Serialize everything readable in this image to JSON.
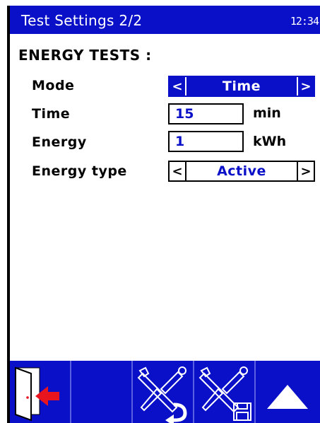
{
  "window": {
    "title": "Test Settings 2/2",
    "clock": "12:34"
  },
  "section": {
    "title": "ENERGY TESTS :"
  },
  "fields": {
    "mode": {
      "label": "Mode",
      "value": "Time",
      "left": "<",
      "right": ">"
    },
    "time": {
      "label": "Time",
      "value": "15",
      "unit": "min"
    },
    "energy": {
      "label": "Energy",
      "value": "1",
      "unit": "kWh"
    },
    "energy_type": {
      "label": "Energy type",
      "value": "Active",
      "left": "<",
      "right": ">"
    }
  },
  "toolbar": {
    "buttons": [
      {
        "icon": "exit-door-icon"
      },
      {
        "icon": "empty"
      },
      {
        "icon": "tools-undo-icon"
      },
      {
        "icon": "tools-save-icon"
      },
      {
        "icon": "up-arrow-icon"
      }
    ]
  },
  "colors": {
    "accent": "#0a10c8",
    "exit_arrow": "#e8141e"
  }
}
